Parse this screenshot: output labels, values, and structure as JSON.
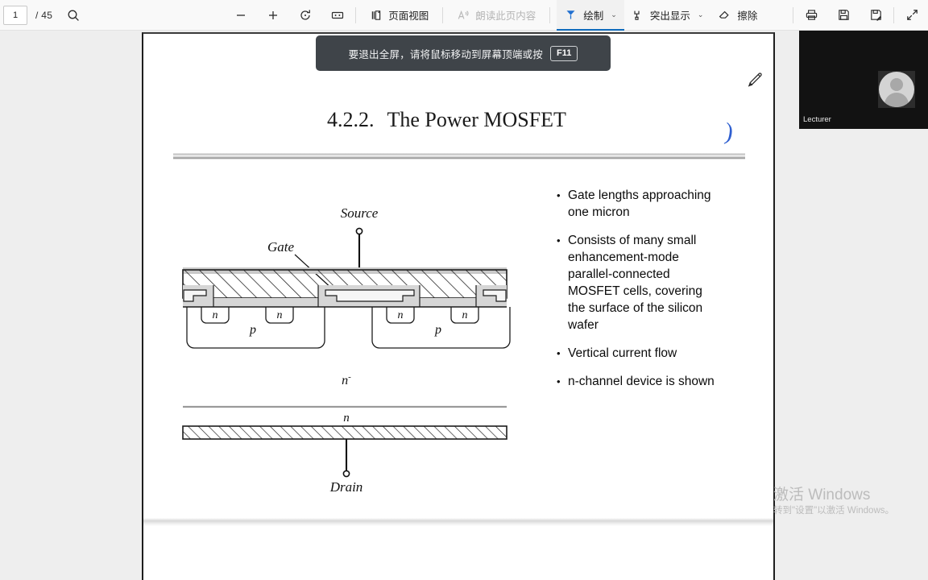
{
  "toolbar": {
    "page_current": "1",
    "page_total": "/ 45",
    "search_icon": "search-icon",
    "zoom_out_label": "−",
    "zoom_in_label": "+",
    "rotate_icon": "rotate-icon",
    "fit_page_icon": "fit-page-icon",
    "page_view_label": "页面视图",
    "read_aloud_label": "朗读此页内容",
    "draw_label": "绘制",
    "highlight_label": "突出显示",
    "erase_label": "擦除",
    "print_icon": "print-icon",
    "save_icon": "save-icon",
    "save_as_icon": "save-as-icon",
    "fullscreen_icon": "expand-icon",
    "caret": "⌄"
  },
  "toast": {
    "message": "要退出全屏，请将鼠标移动到屏幕顶端或按",
    "key": "F11"
  },
  "slide": {
    "number": "4.2.2.",
    "title": "The Power MOSFET",
    "ink_mark": ")",
    "bullets": [
      "Gate lengths approaching one micron",
      "Consists of many small enhancement-mode parallel-connected MOSFET cells, covering the surface of the silicon wafer",
      "Vertical current flow",
      "n-channel device is shown"
    ],
    "bullet_marker": "•",
    "figure": {
      "source_label": "Source",
      "gate_label": "Gate",
      "drain_label": "Drain",
      "n_label": "n",
      "p_label": "p",
      "n_minus_label": "n",
      "n_minus_sup": "-",
      "substrate_label": "n"
    }
  },
  "video": {
    "label": "Lecturer",
    "avatar_icon": "person-avatar-icon"
  },
  "watermark": {
    "line1": "激活 Windows",
    "line2": "转到\"设置\"以激活 Windows。"
  },
  "colors": {
    "accent": "#0f6cbd",
    "ink": "#2f5fd0",
    "toast_bg": "#3f4449",
    "toolbar_bg": "#f9f9f9"
  }
}
